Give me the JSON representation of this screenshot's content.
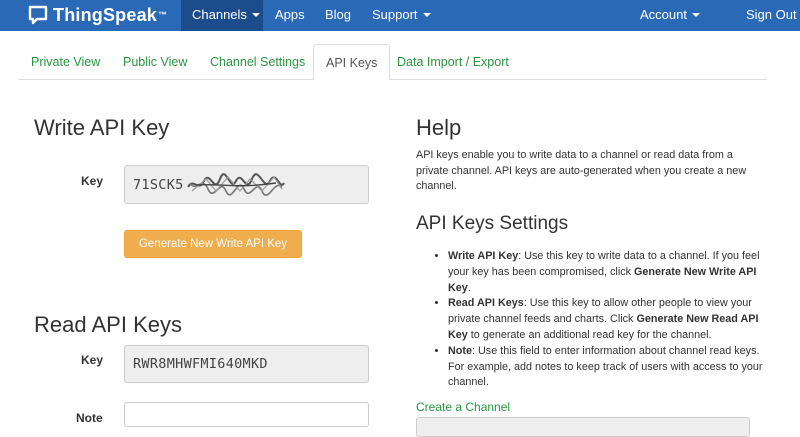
{
  "brand": {
    "name": "ThingSpeak",
    "tm": "™",
    "icon": "speech-bubble-icon"
  },
  "nav": {
    "channels": "Channels",
    "apps": "Apps",
    "blog": "Blog",
    "support": "Support",
    "account": "Account",
    "sign_out": "Sign Out"
  },
  "tabs": {
    "private_view": "Private View",
    "public_view": "Public View",
    "channel_settings": "Channel Settings",
    "api_keys": "API Keys",
    "data_import_export": "Data Import / Export",
    "active": "API Keys"
  },
  "write_api": {
    "title": "Write API Key",
    "key_label": "Key",
    "key_value": "71SCK5",
    "key_obscured": true,
    "button": "Generate New Write API Key"
  },
  "read_api": {
    "title": "Read API Keys",
    "key_label": "Key",
    "key_value": "RWR8MHWFMI640MKD",
    "note_label": "Note",
    "note_value": ""
  },
  "help": {
    "title": "Help",
    "intro": "API keys enable you to write data to a channel or read data from a private channel. API keys are auto-generated when you create a new channel.",
    "settings_title": "API Keys Settings",
    "items": [
      {
        "label": "Write API Key",
        "text_before": ": Use this key to write data to a channel. If you feel your key has been compromised, click ",
        "bold_action": "Generate New Write API Key",
        "text_after": "."
      },
      {
        "label": "Read API Keys",
        "text_before": ": Use this key to allow other people to view your private channel feeds and charts. Click ",
        "bold_action": "Generate New Read API Key",
        "text_after": " to generate an additional read key for the channel."
      },
      {
        "label": "Note",
        "text_before": ": Use this field to enter information about channel read keys. For example, add notes to keep track of users with access to your channel.",
        "bold_action": "",
        "text_after": ""
      }
    ],
    "create_channel": "Create a Channel"
  },
  "colors": {
    "navbar": "#2a69b6",
    "navbar_active": "#1c4c8b",
    "link_green": "#27963f",
    "button_orange": "#f0ad4e"
  }
}
